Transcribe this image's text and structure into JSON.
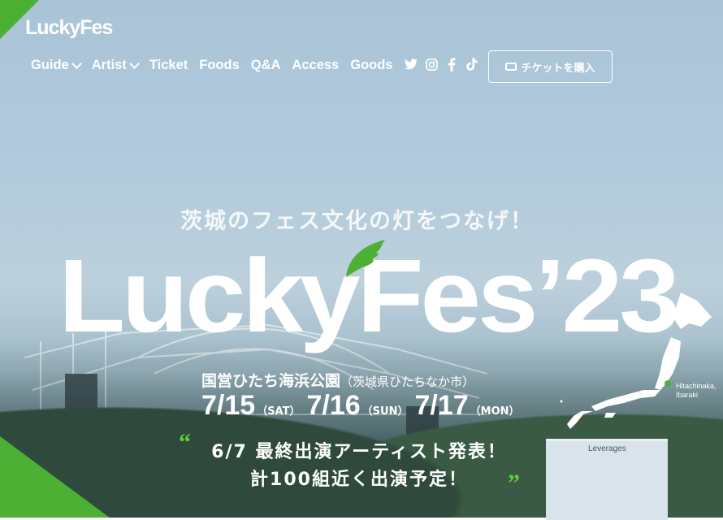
{
  "header": {
    "logo_text": "LuckyFes",
    "nav": [
      {
        "label": "Guide",
        "has_dropdown": true
      },
      {
        "label": "Artist",
        "has_dropdown": true
      },
      {
        "label": "Ticket",
        "has_dropdown": false
      },
      {
        "label": "Foods",
        "has_dropdown": false
      },
      {
        "label": "Q&A",
        "has_dropdown": false
      },
      {
        "label": "Access",
        "has_dropdown": false
      },
      {
        "label": "Goods",
        "has_dropdown": false
      }
    ],
    "social_icons": [
      "twitter-icon",
      "instagram-icon",
      "facebook-icon",
      "tiktok-icon"
    ],
    "ticket_button": "チケットを購入"
  },
  "hero": {
    "tagline": "茨城のフェス文化の灯をつなげ！",
    "logo_text": "LuckyFes’23",
    "venue": "国営ひたち海浜公園",
    "venue_sub": "（茨城県ひたちなか市）",
    "dates": [
      {
        "date": "7/15",
        "weekday": "（SAT）"
      },
      {
        "date": "7/16",
        "weekday": "（SUN）"
      },
      {
        "date": "7/17",
        "weekday": "（MON）"
      }
    ],
    "announce_line1": "6/7 最終出演アーティスト発表！",
    "announce_line2": "計100組近く出演予定！",
    "map_label_line1": "Hitachinaka,",
    "map_label_line2": "Ibaraki",
    "stage_banner": "Leverages"
  },
  "colors": {
    "accent_green": "#4cb035",
    "quote_green": "#5bd03a",
    "text": "#ffffff"
  }
}
